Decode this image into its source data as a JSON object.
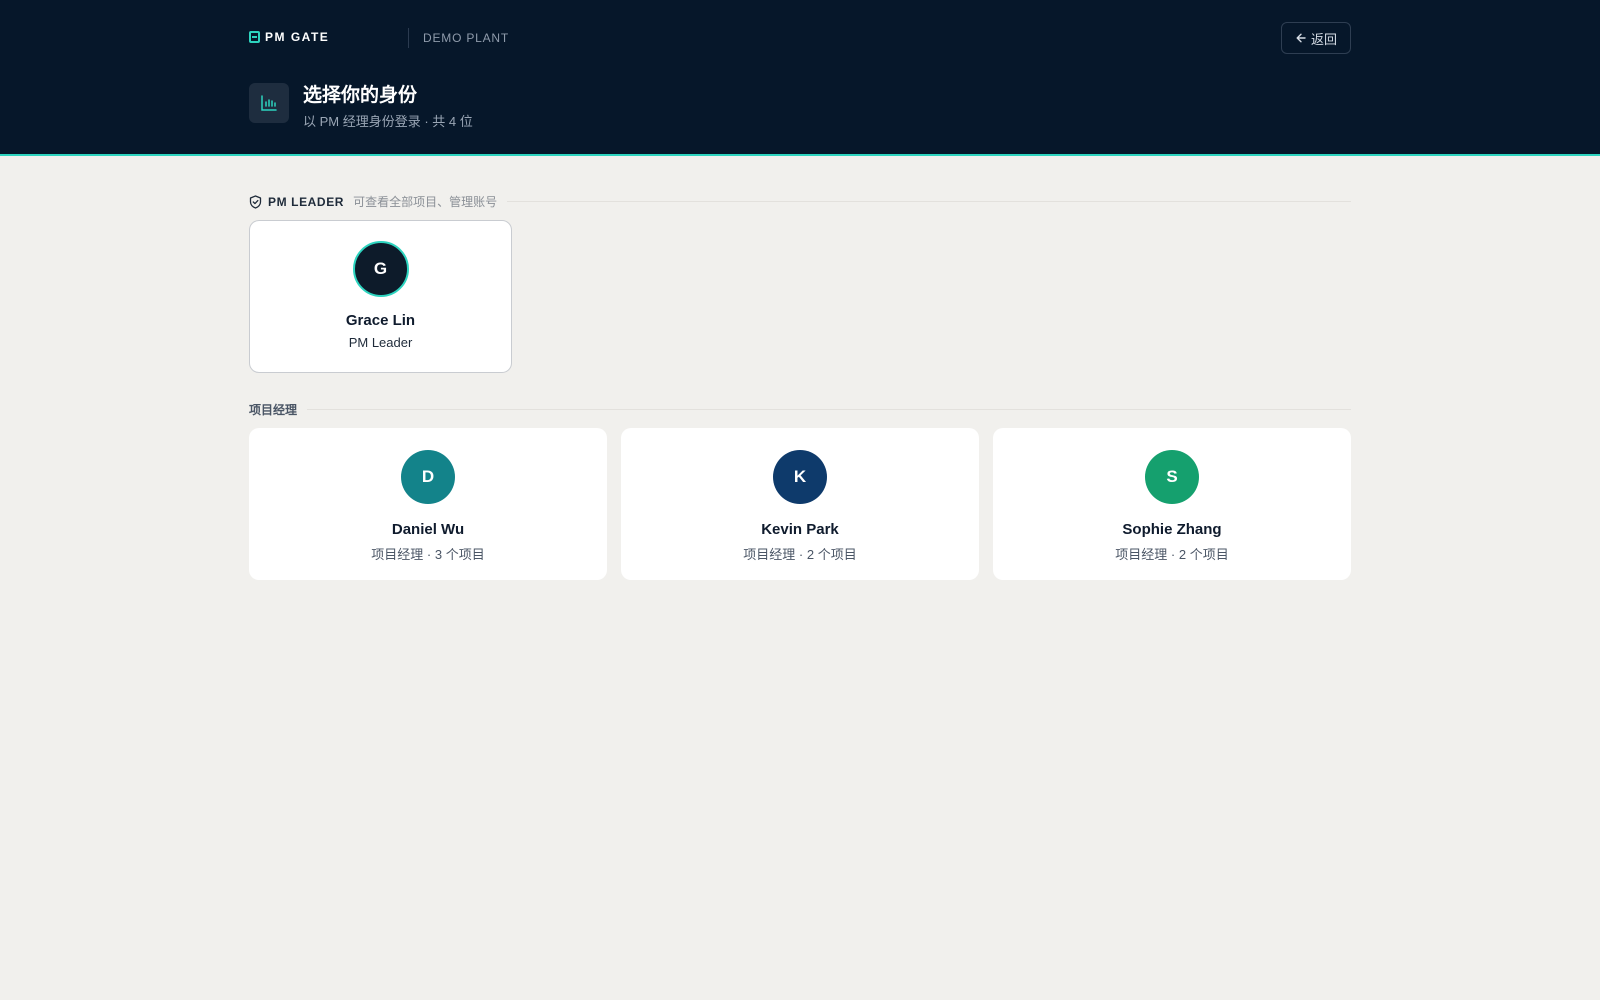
{
  "header": {
    "brand": "PM GATE",
    "plant": "DEMO PLANT",
    "back_label": "返回",
    "title": "选择你的身份",
    "subtitle": "以 PM 经理身份登录 · 共 4 位"
  },
  "leader_section": {
    "tag": "PM LEADER",
    "description": "可查看全部项目、管理账号",
    "card": {
      "initial": "G",
      "name": "Grace Lin",
      "role": "PM Leader",
      "color": "#0d1b2a"
    }
  },
  "pm_section": {
    "label": "项目经理",
    "cards": [
      {
        "initial": "D",
        "name": "Daniel Wu",
        "role": "项目经理 · 3 个项目",
        "color": "#13838a"
      },
      {
        "initial": "K",
        "name": "Kevin Park",
        "role": "项目经理 · 2 个项目",
        "color": "#0e3a6b"
      },
      {
        "initial": "S",
        "name": "Sophie Zhang",
        "role": "项目经理 · 2 个项目",
        "color": "#15a06e"
      }
    ]
  },
  "colors": {
    "accent": "#2dd4bf",
    "header_bg": "#06172a",
    "page_bg": "#f1f0ed"
  }
}
